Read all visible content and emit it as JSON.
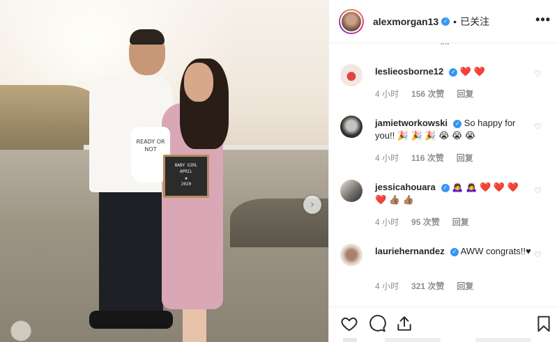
{
  "post": {
    "image_alt_elements": {
      "onesie_text": "READY OR NOT",
      "letterboard_line1": "BABY GIRL",
      "letterboard_line2": "APRIL",
      "letterboard_line3": "2020",
      "letterboard_star": "★"
    },
    "carousel_next_icon": "chevron-right-icon"
  },
  "header": {
    "username": "alexmorgan13",
    "verified_glyph": "✓",
    "separator": "•",
    "follow_label": "已关注",
    "more_icon": "•••"
  },
  "comments": [
    {
      "username": "leslieosborne12",
      "text": "❤️ ❤️",
      "time": "4 小时",
      "likes": "156 次赞",
      "reply": "回复"
    },
    {
      "username": "jamietworkowski",
      "text": "So happy for you!! 🎉 🎉 🎉 😭 😭 😭",
      "time": "4 小时",
      "likes": "116 次赞",
      "reply": "回复"
    },
    {
      "username": "jessicahouara",
      "text": "🙇‍♀️ 🙇‍♀️ ❤️ ❤️ ❤️ ❤️ 👍🏽 👍🏽",
      "time": "4 小时",
      "likes": "95 次赞",
      "reply": "回复"
    },
    {
      "username": "lauriehernandez",
      "text": "AWW congrats!!♥",
      "time": "4 小时",
      "likes": "321 次赞",
      "reply": "回复"
    }
  ],
  "actions": {
    "like_icon": "heart-outline-icon",
    "comment_icon": "comment-bubble-icon",
    "share_icon": "share-icon",
    "save_icon": "bookmark-icon"
  },
  "colors": {
    "verified": "#3897f0",
    "meta_text": "#8e8e8e",
    "border": "#efefef"
  }
}
